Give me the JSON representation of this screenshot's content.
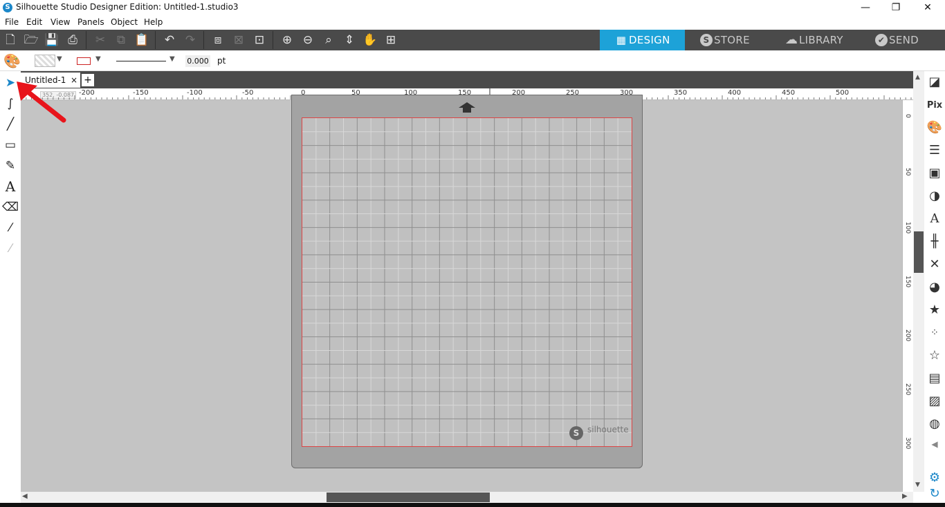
{
  "app": {
    "title": "Silhouette Studio Designer Edition: Untitled-1.studio3",
    "icon": "silhouette-logo-icon"
  },
  "window_controls": {
    "minimize": "—",
    "restore": "❐",
    "close": "✕"
  },
  "menu": [
    "File",
    "Edit",
    "View",
    "Panels",
    "Object",
    "Help"
  ],
  "nav_tabs": [
    {
      "label": "DESIGN",
      "icon": "grid-icon",
      "glyph": "▦",
      "active": true
    },
    {
      "label": "STORE",
      "icon": "silhouette-s-icon",
      "glyph": "S",
      "active": false
    },
    {
      "label": "LIBRARY",
      "icon": "cloud-download-icon",
      "glyph": "☁",
      "active": false
    },
    {
      "label": "SEND",
      "icon": "check-circle-icon",
      "glyph": "✔",
      "active": false
    }
  ],
  "properties": {
    "line_width_value": "0.000",
    "line_width_unit": "pt",
    "line_color": "#cc2222"
  },
  "document_tab": {
    "label": "Untitled-1",
    "close": "×",
    "new_tab": "+"
  },
  "ruler": {
    "coord_readout": "352, -0.087",
    "h_labels": [
      "-200",
      "-150",
      "-100",
      "-50",
      "0",
      "50",
      "100",
      "150",
      "200",
      "250",
      "300",
      "350",
      "400",
      "450",
      "500"
    ],
    "v_labels": [
      "0",
      "50",
      "100",
      "150",
      "200",
      "250",
      "300"
    ]
  },
  "mat": {
    "brand": "silhouette",
    "grid_columns": 12,
    "grid_rows": 12
  },
  "colors": {
    "accent": "#1da2d8",
    "toolbar": "#4a4a4a",
    "canvas": "#c4c4c4",
    "cut_border": "#dd4444",
    "annotation_arrow": "#e8141b"
  }
}
